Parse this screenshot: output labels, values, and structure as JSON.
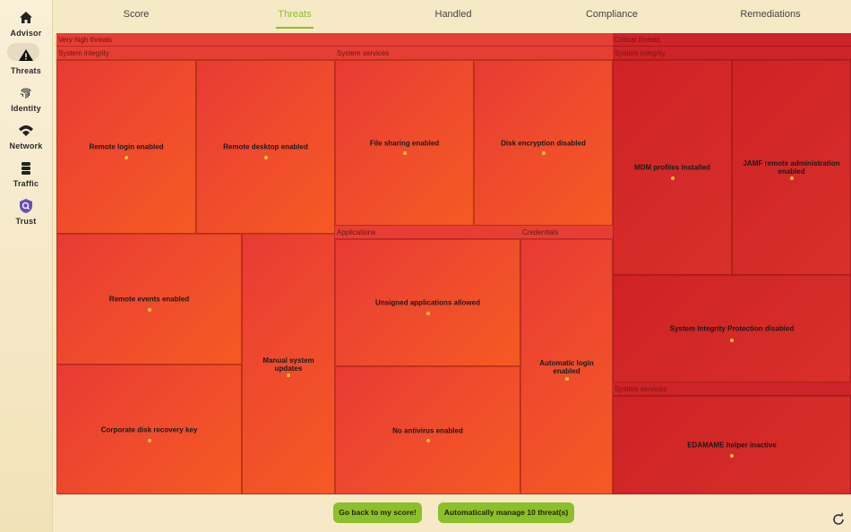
{
  "sidebar": {
    "items": [
      {
        "label": "Advisor",
        "icon": "home-icon"
      },
      {
        "label": "Threats",
        "icon": "warning-icon",
        "active": true
      },
      {
        "label": "Identity",
        "icon": "fingerprint-icon"
      },
      {
        "label": "Network",
        "icon": "wifi-icon"
      },
      {
        "label": "Traffic",
        "icon": "database-icon"
      },
      {
        "label": "Trust",
        "icon": "shield-search-icon"
      }
    ]
  },
  "tabs": [
    {
      "label": "Score"
    },
    {
      "label": "Threats",
      "active": true
    },
    {
      "label": "Handled"
    },
    {
      "label": "Compliance"
    },
    {
      "label": "Remediations"
    }
  ],
  "treemap": {
    "very_high": {
      "title": "Very high threats",
      "system_integrity": {
        "title": "System integrity",
        "cells": [
          "Remote login enabled",
          "Remote desktop enabled",
          "Remote events enabled",
          "Manual system updates",
          "Corporate disk recovery key"
        ]
      },
      "system_services": {
        "title": "System services",
        "cells": [
          "File sharing enabled",
          "Disk encryption disabled"
        ]
      },
      "applications": {
        "title": "Applications",
        "cells": [
          "Unsigned applications allowed",
          "No antivirus enabled"
        ]
      },
      "credentials": {
        "title": "Credentials",
        "cells": [
          "Automatic login enabled"
        ]
      }
    },
    "critical": {
      "title": "Critical threats",
      "system_integrity": {
        "title": "System integrity",
        "cells": [
          "MDM profiles installed",
          "JAMF remote administration enabled",
          "System Integrity Protection disabled"
        ]
      },
      "system_services": {
        "title": "System services",
        "cells": [
          "EDAMAME helper inactive"
        ]
      }
    }
  },
  "actions": {
    "back_label": "Go back to my score!",
    "manage_label": "Automatically manage 10 threat(s)"
  },
  "colors": {
    "accent": "#8cbf2b",
    "very_high": "#e8402f",
    "critical": "#cf2226"
  }
}
